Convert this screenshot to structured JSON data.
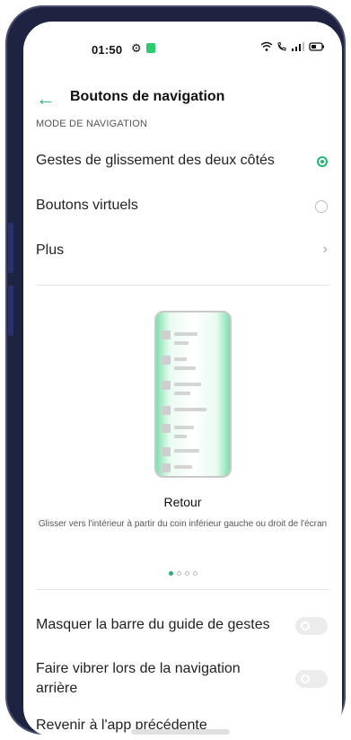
{
  "status": {
    "time": "01:50",
    "icons": [
      "settings-gear-icon",
      "app-notification-icon",
      "wifi-icon",
      "call-icon",
      "signal-icon",
      "battery-icon"
    ]
  },
  "header": {
    "title": "Boutons de navigation",
    "back_icon": "back-arrow-icon"
  },
  "section": {
    "label": "MODE DE NAVIGATION"
  },
  "options": [
    {
      "label": "Gestes de glissement des deux côtés",
      "control": "radio",
      "selected": true
    },
    {
      "label": "Boutons virtuels",
      "control": "radio",
      "selected": false
    },
    {
      "label": "Plus",
      "control": "chevron"
    }
  ],
  "illustration": {
    "title": "Retour",
    "description": "Glisser vers l'intérieur à partir du coin inférieur gauche ou droit de l'écran",
    "pages": 4,
    "active_page": 1
  },
  "toggles": [
    {
      "label": "Masquer la barre du guide de gestes",
      "on": false
    },
    {
      "label": "Faire vibrer lors de la navigation arrière",
      "on": false
    },
    {
      "label": "Revenir à l'app précédente",
      "on": false
    }
  ],
  "colors": {
    "accent": "#22b573",
    "frame": "#1d2340"
  }
}
